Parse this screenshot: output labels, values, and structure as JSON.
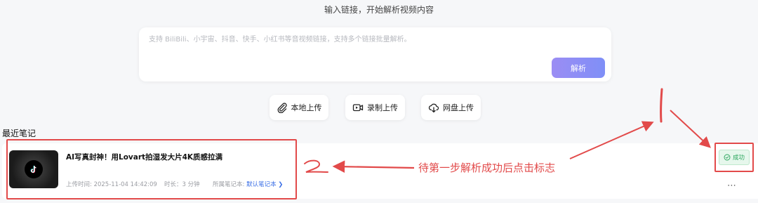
{
  "header": {
    "text": "输入链接，开始解析视频内容"
  },
  "input": {
    "placeholder": "支持 BiliBili、小宇宙、抖音、快手、小红书等音视频链接，支持多个链接批量解析。",
    "value": ""
  },
  "parse_button": {
    "label": "解析"
  },
  "uploads": [
    {
      "label": "本地上传",
      "icon": "paperclip-icon"
    },
    {
      "label": "录制上传",
      "icon": "video-record-icon"
    },
    {
      "label": "网盘上传",
      "icon": "cloud-upload-icon"
    }
  ],
  "recent": {
    "title": "最近笔记",
    "notes": [
      {
        "title": "AI写真封神！用Lovart拍湿发大片4K质感拉满",
        "upload_time": "上传时间: 2025-11-04 14:42:09",
        "duration": "时长：3 分钟",
        "notebook_label": "所属笔记本: ",
        "notebook_name": "默认笔记本 ❯",
        "status": "成功",
        "more": "⋯",
        "thumbnail_icon": "tiktok-logo-icon"
      }
    ]
  },
  "annotations": {
    "instruction": "待第一步解析成功后点击标志",
    "step1": "1",
    "step2": "2",
    "color": "#e24a4a"
  }
}
